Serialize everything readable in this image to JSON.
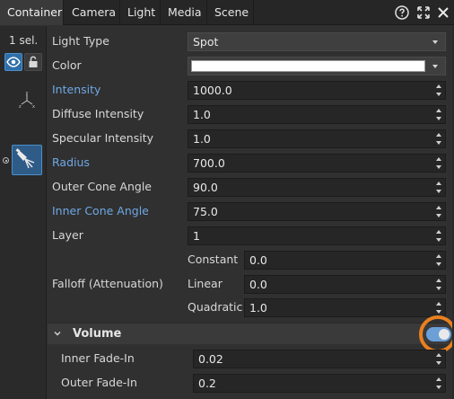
{
  "tabs": [
    {
      "label": "Container",
      "active": true
    },
    {
      "label": "Camera",
      "active": false
    },
    {
      "label": "Light",
      "active": false
    },
    {
      "label": "Media",
      "active": false
    },
    {
      "label": "Scene",
      "active": false
    }
  ],
  "tab_icons": [
    "help-icon",
    "expand-icon",
    "close-icon"
  ],
  "left": {
    "selection": "1 sel."
  },
  "properties": {
    "light_type": {
      "label": "Light Type",
      "value": "Spot"
    },
    "color": {
      "label": "Color",
      "value": "#ffffff"
    },
    "intensity": {
      "label": "Intensity",
      "value": "1000.0"
    },
    "diffuse_intensity": {
      "label": "Diffuse Intensity",
      "value": "1.0"
    },
    "specular_intensity": {
      "label": "Specular Intensity",
      "value": "1.0"
    },
    "radius": {
      "label": "Radius",
      "value": "700.0"
    },
    "outer_cone_angle": {
      "label": "Outer Cone Angle",
      "value": "90.0"
    },
    "inner_cone_angle": {
      "label": "Inner Cone Angle",
      "value": "75.0"
    },
    "layer": {
      "label": "Layer",
      "value": "1"
    },
    "falloff": {
      "label": "Falloff (Attenuation)",
      "constant": {
        "label": "Constant",
        "value": "0.0"
      },
      "linear": {
        "label": "Linear",
        "value": "0.0"
      },
      "quadratic": {
        "label": "Quadratic",
        "value": "1.0"
      }
    }
  },
  "volume": {
    "title": "Volume",
    "enabled": true,
    "inner_fade_in": {
      "label": "Inner Fade-In",
      "value": "0.02"
    },
    "outer_fade_in": {
      "label": "Outer Fade-In",
      "value": "0.2"
    }
  },
  "colors": {
    "accent": "#2f6fa8",
    "link_label": "#6ea8e6",
    "highlight": "#e9801f",
    "toggle": "#6c9fd6"
  }
}
